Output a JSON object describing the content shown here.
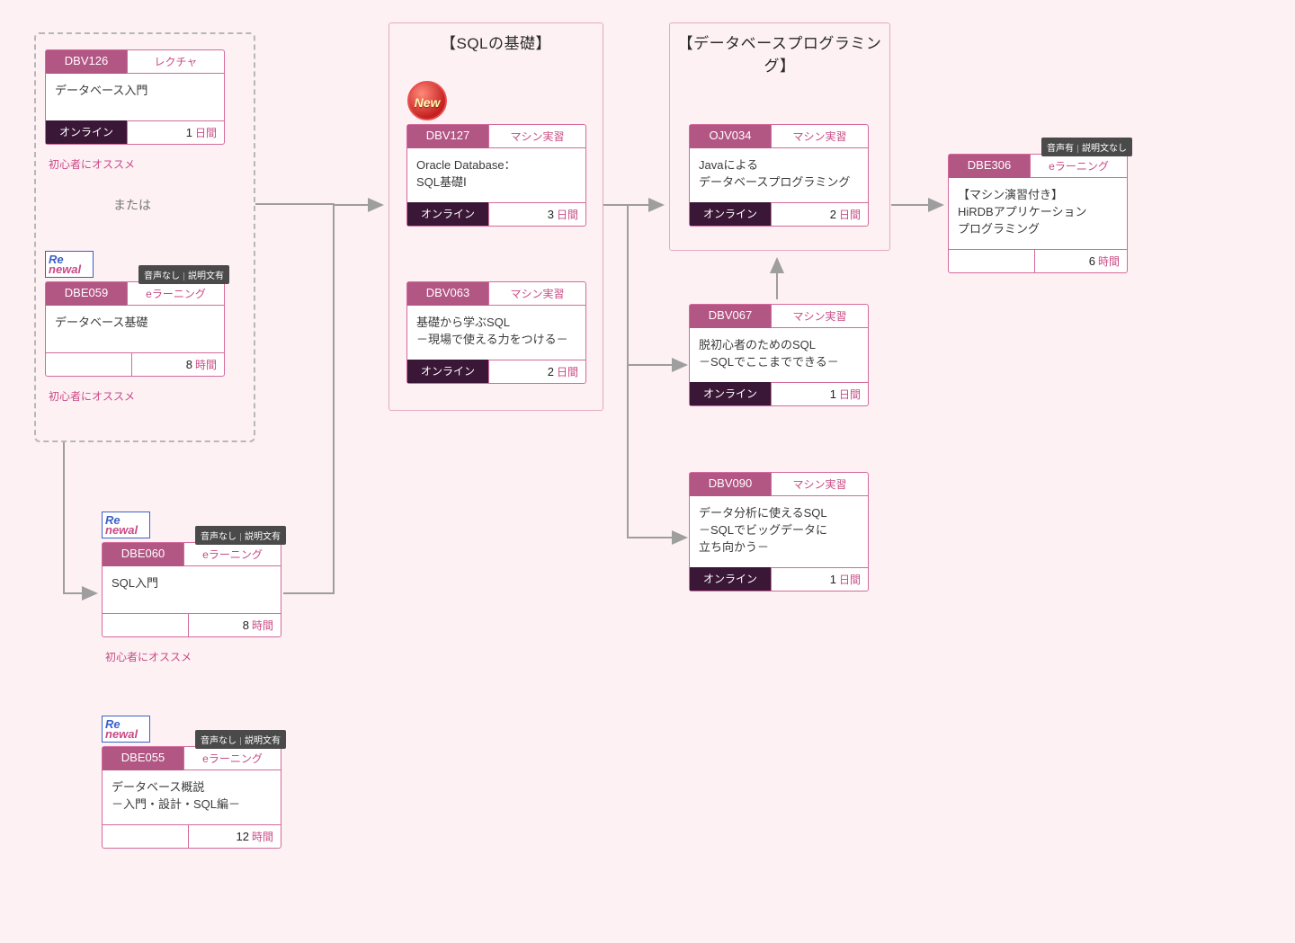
{
  "labels": {
    "or": "または",
    "recommend_beginner": "初心者にオススメ",
    "audio_none_explain_yes": "音声なし|説明文有",
    "audio_yes_explain_none": "音声有|説明文なし",
    "renewal_1": "Re",
    "renewal_2": "newal",
    "new": "New"
  },
  "modes": {
    "lecture": "レクチャ",
    "elearning": "eラーニング",
    "machine": "マシン実習"
  },
  "format": {
    "online": "オンライン"
  },
  "duration_unit": {
    "days": "日間",
    "hours": "時間"
  },
  "groups": {
    "intro": {
      "label": ""
    },
    "sql_basics": {
      "label": "【SQLの基礎】"
    },
    "db_programming": {
      "label": "【データベースプログラミング】"
    }
  },
  "cards": {
    "DBV126": {
      "code": "DBV126",
      "mode": "レクチャ",
      "title": "データベース入門",
      "format": "オンライン",
      "duration_value": "1",
      "duration_unit": "日間"
    },
    "DBE059": {
      "code": "DBE059",
      "mode": "eラーニング",
      "title": "データベース基礎",
      "format": "",
      "duration_value": "8",
      "duration_unit": "時間"
    },
    "DBE060": {
      "code": "DBE060",
      "mode": "eラーニング",
      "title": "SQL入門",
      "format": "",
      "duration_value": "8",
      "duration_unit": "時間"
    },
    "DBE055": {
      "code": "DBE055",
      "mode": "eラーニング",
      "title": "データベース概説\n－入門・設計・SQL編－",
      "format": "",
      "duration_value": "12",
      "duration_unit": "時間"
    },
    "DBV127": {
      "code": "DBV127",
      "mode": "マシン実習",
      "title": "Oracle Database：\nSQL基礎Ⅰ",
      "format": "オンライン",
      "duration_value": "3",
      "duration_unit": "日間"
    },
    "DBV063": {
      "code": "DBV063",
      "mode": "マシン実習",
      "title": "基礎から学ぶSQL\n－現場で使える力をつける－",
      "format": "オンライン",
      "duration_value": "2",
      "duration_unit": "日間"
    },
    "OJV034": {
      "code": "OJV034",
      "mode": "マシン実習",
      "title": "Javaによる\nデータベースプログラミング",
      "format": "オンライン",
      "duration_value": "2",
      "duration_unit": "日間"
    },
    "DBV067": {
      "code": "DBV067",
      "mode": "マシン実習",
      "title": "脱初心者のためのSQL\n－SQLでここまでできる－",
      "format": "オンライン",
      "duration_value": "1",
      "duration_unit": "日間"
    },
    "DBV090": {
      "code": "DBV090",
      "mode": "マシン実習",
      "title": "データ分析に使えるSQL\n－SQLでビッグデータに\n立ち向かう－",
      "format": "オンライン",
      "duration_value": "1",
      "duration_unit": "日間"
    },
    "DBE306": {
      "code": "DBE306",
      "mode": "eラーニング",
      "title": "【マシン演習付き】\nHiRDBアプリケーション\nプログラミング",
      "format": "",
      "duration_value": "6",
      "duration_unit": "時間"
    }
  }
}
